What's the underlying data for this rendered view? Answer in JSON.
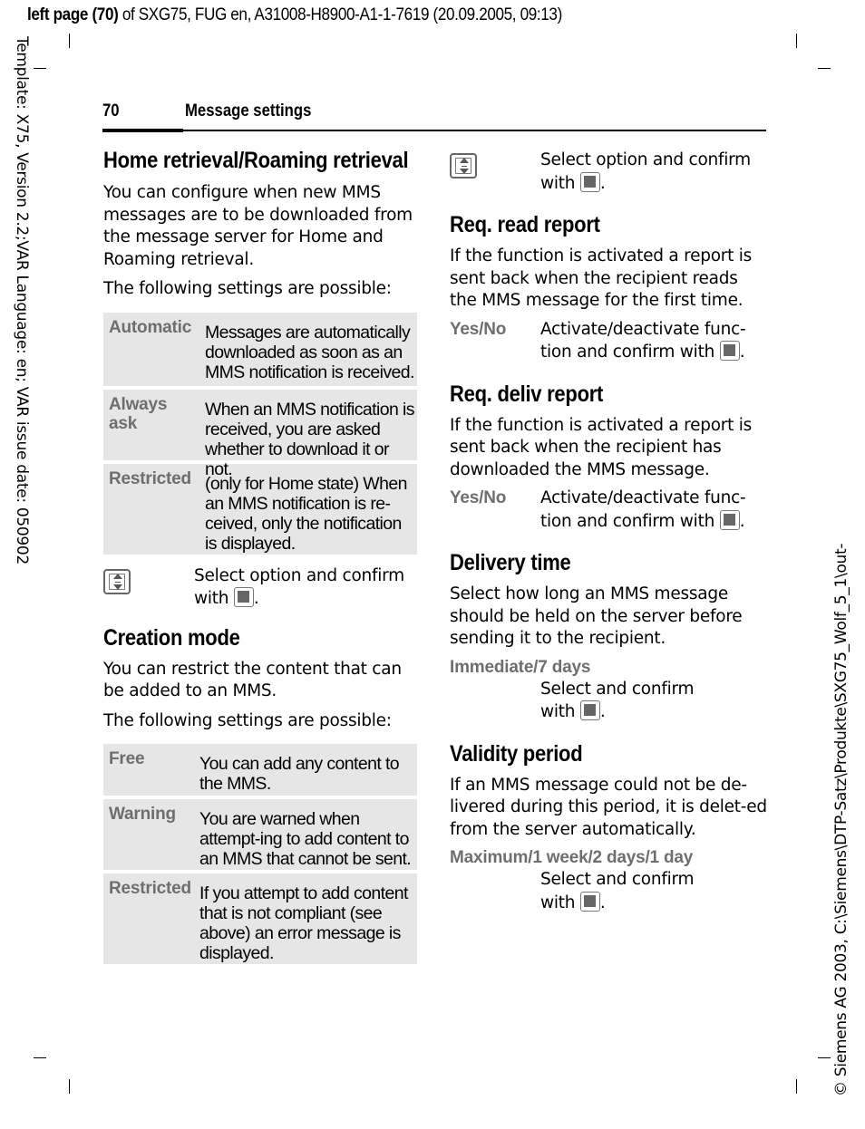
{
  "meta": {
    "top_bold": "left page (70)",
    "top_rest": " of SXG75, FUG en, A31008-H8900-A1-1-7619 (20.09.2005, 09:13)",
    "side_left": "Template: X75, Version 2.2;VAR Language: en; VAR issue date: 050902",
    "side_right": "© Siemens AG 2003, C:\\Siemens\\DTP-Satz\\Produkte\\SXG75_Wolf_5_1\\out-"
  },
  "header": {
    "page_number": "70",
    "section_title": "Message settings"
  },
  "left": {
    "home": {
      "title": "Home retrieval/Roaming retrieval",
      "intro": "You can configure when new MMS messages are to be downloaded from the message server for Home and Roaming retrieval.",
      "possible": "The following settings are possible:",
      "options": [
        {
          "key": "Automatic",
          "value": "Messages are automatically downloaded as soon as an MMS notification is received."
        },
        {
          "key": "Always ask",
          "value": "When an MMS notification is received, you are asked whether to download it or not."
        },
        {
          "key": "Restricted",
          "value": "(only for Home state) When an MMS notification is re-ceived, only the notification is displayed."
        }
      ],
      "instruction_pre": "Select option and confirm with ",
      "instruction_post": "."
    },
    "creation": {
      "title": "Creation mode",
      "intro": "You can restrict the content that can be added to an MMS.",
      "possible": "The following settings are possible:",
      "options": [
        {
          "key": "Free",
          "value": "You can add any content to the MMS."
        },
        {
          "key": "Warning",
          "value": "You are warned when attempt-ing to add content to an MMS that cannot be sent."
        },
        {
          "key": "Restricted",
          "value": "If you attempt to add content that is not compliant (see above) an error message is displayed."
        }
      ]
    }
  },
  "right": {
    "top_instruction_pre": "Select option and confirm with ",
    "top_instruction_post": ".",
    "read_report": {
      "title": "Req. read report",
      "intro": "If the function is activated a report is sent back when the recipient reads the MMS message for the first time.",
      "label": "Yes/No",
      "desc_pre": "Activate/deactivate func-tion and confirm with ",
      "desc_post": "."
    },
    "deliv_report": {
      "title": "Req. deliv report",
      "intro": "If the function is activated a report is sent back when the recipient has downloaded the MMS message.",
      "label": "Yes/No",
      "desc_pre": "Activate/deactivate func-tion and confirm with ",
      "desc_post": "."
    },
    "delivery_time": {
      "title": "Delivery time",
      "intro": "Select how long an MMS message should be held on the server before sending it to the recipient.",
      "label": "Immediate/7 days",
      "desc_pre": "Select and confirm with ",
      "desc_post": "."
    },
    "validity": {
      "title": "Validity period",
      "intro": "If an MMS message could not be de-livered during this period, it is delet-ed from the server automatically.",
      "label": "Maximum/1 week/2 days/1 day",
      "desc_pre": "Select and confirm with ",
      "desc_post": "."
    }
  },
  "icons": {
    "nav": "navigation-key-icon",
    "confirm": "center-key-icon"
  }
}
